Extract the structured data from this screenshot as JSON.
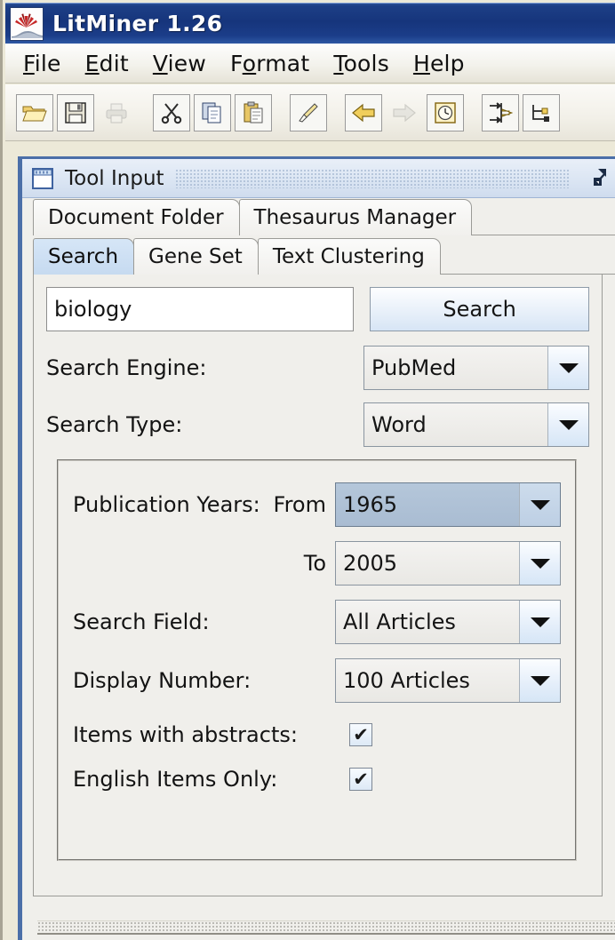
{
  "window": {
    "title": "LitMiner  1.26",
    "icon": "litminer-app-icon"
  },
  "menubar": {
    "items": [
      {
        "label": "File",
        "mnemonic_index": 0
      },
      {
        "label": "Edit",
        "mnemonic_index": 0
      },
      {
        "label": "View",
        "mnemonic_index": 0
      },
      {
        "label": "Format",
        "mnemonic_index": 1
      },
      {
        "label": "Tools",
        "mnemonic_index": 0
      },
      {
        "label": "Help",
        "mnemonic_index": 0
      }
    ]
  },
  "toolbar": {
    "buttons": [
      {
        "name": "open-folder-icon",
        "enabled": true
      },
      {
        "name": "save-floppy-icon",
        "enabled": true
      },
      {
        "name": "print-icon",
        "enabled": false
      },
      {
        "name": "cut-scissors-icon",
        "enabled": true
      },
      {
        "name": "copy-icon",
        "enabled": true
      },
      {
        "name": "paste-clipboard-icon",
        "enabled": true
      },
      {
        "name": "paintbrush-icon",
        "enabled": true
      },
      {
        "name": "back-arrow-icon",
        "enabled": true
      },
      {
        "name": "forward-arrow-icon",
        "enabled": false
      },
      {
        "name": "history-clock-icon",
        "enabled": true
      },
      {
        "name": "align-arrows-icon",
        "enabled": true
      },
      {
        "name": "tree-node-icon",
        "enabled": true
      }
    ]
  },
  "panel": {
    "title": "Tool Input",
    "icon": "window-notepad-icon",
    "expand_icon": "expand-arrow-icon"
  },
  "tabs": {
    "row1": [
      {
        "label": "Document Folder",
        "active": false
      },
      {
        "label": "Thesaurus Manager",
        "active": false
      }
    ],
    "row2": [
      {
        "label": "Search",
        "active": true
      },
      {
        "label": "Gene Set",
        "active": false
      },
      {
        "label": "Text Clustering",
        "active": false
      }
    ]
  },
  "search_form": {
    "query_value": "biology",
    "query_placeholder": "",
    "search_button_label": "Search",
    "search_engine": {
      "label": "Search Engine:",
      "value": "PubMed"
    },
    "search_type": {
      "label": "Search Type:",
      "value": "Word"
    }
  },
  "options_group": {
    "publication_years": {
      "label": "Publication Years:",
      "from_label": "From",
      "from_value": "1965",
      "to_label": "To",
      "to_value": "2005"
    },
    "search_field": {
      "label": "Search Field:",
      "value": "All Articles"
    },
    "display_number": {
      "label": "Display Number:",
      "value": "100 Articles"
    },
    "items_with_abstracts": {
      "label": "Items with abstracts:",
      "checked": true,
      "mark": "✔"
    },
    "english_items_only": {
      "label": "English Items Only:",
      "checked": true,
      "mark": "✔"
    }
  },
  "colors": {
    "titlebar_blue": "#16357c",
    "panel_border_blue": "#4b6fa8",
    "active_tab_blue": "#c6daf0",
    "selected_combo_blue": "#b5c7da",
    "toolbar_gold": "#e8b93a"
  }
}
